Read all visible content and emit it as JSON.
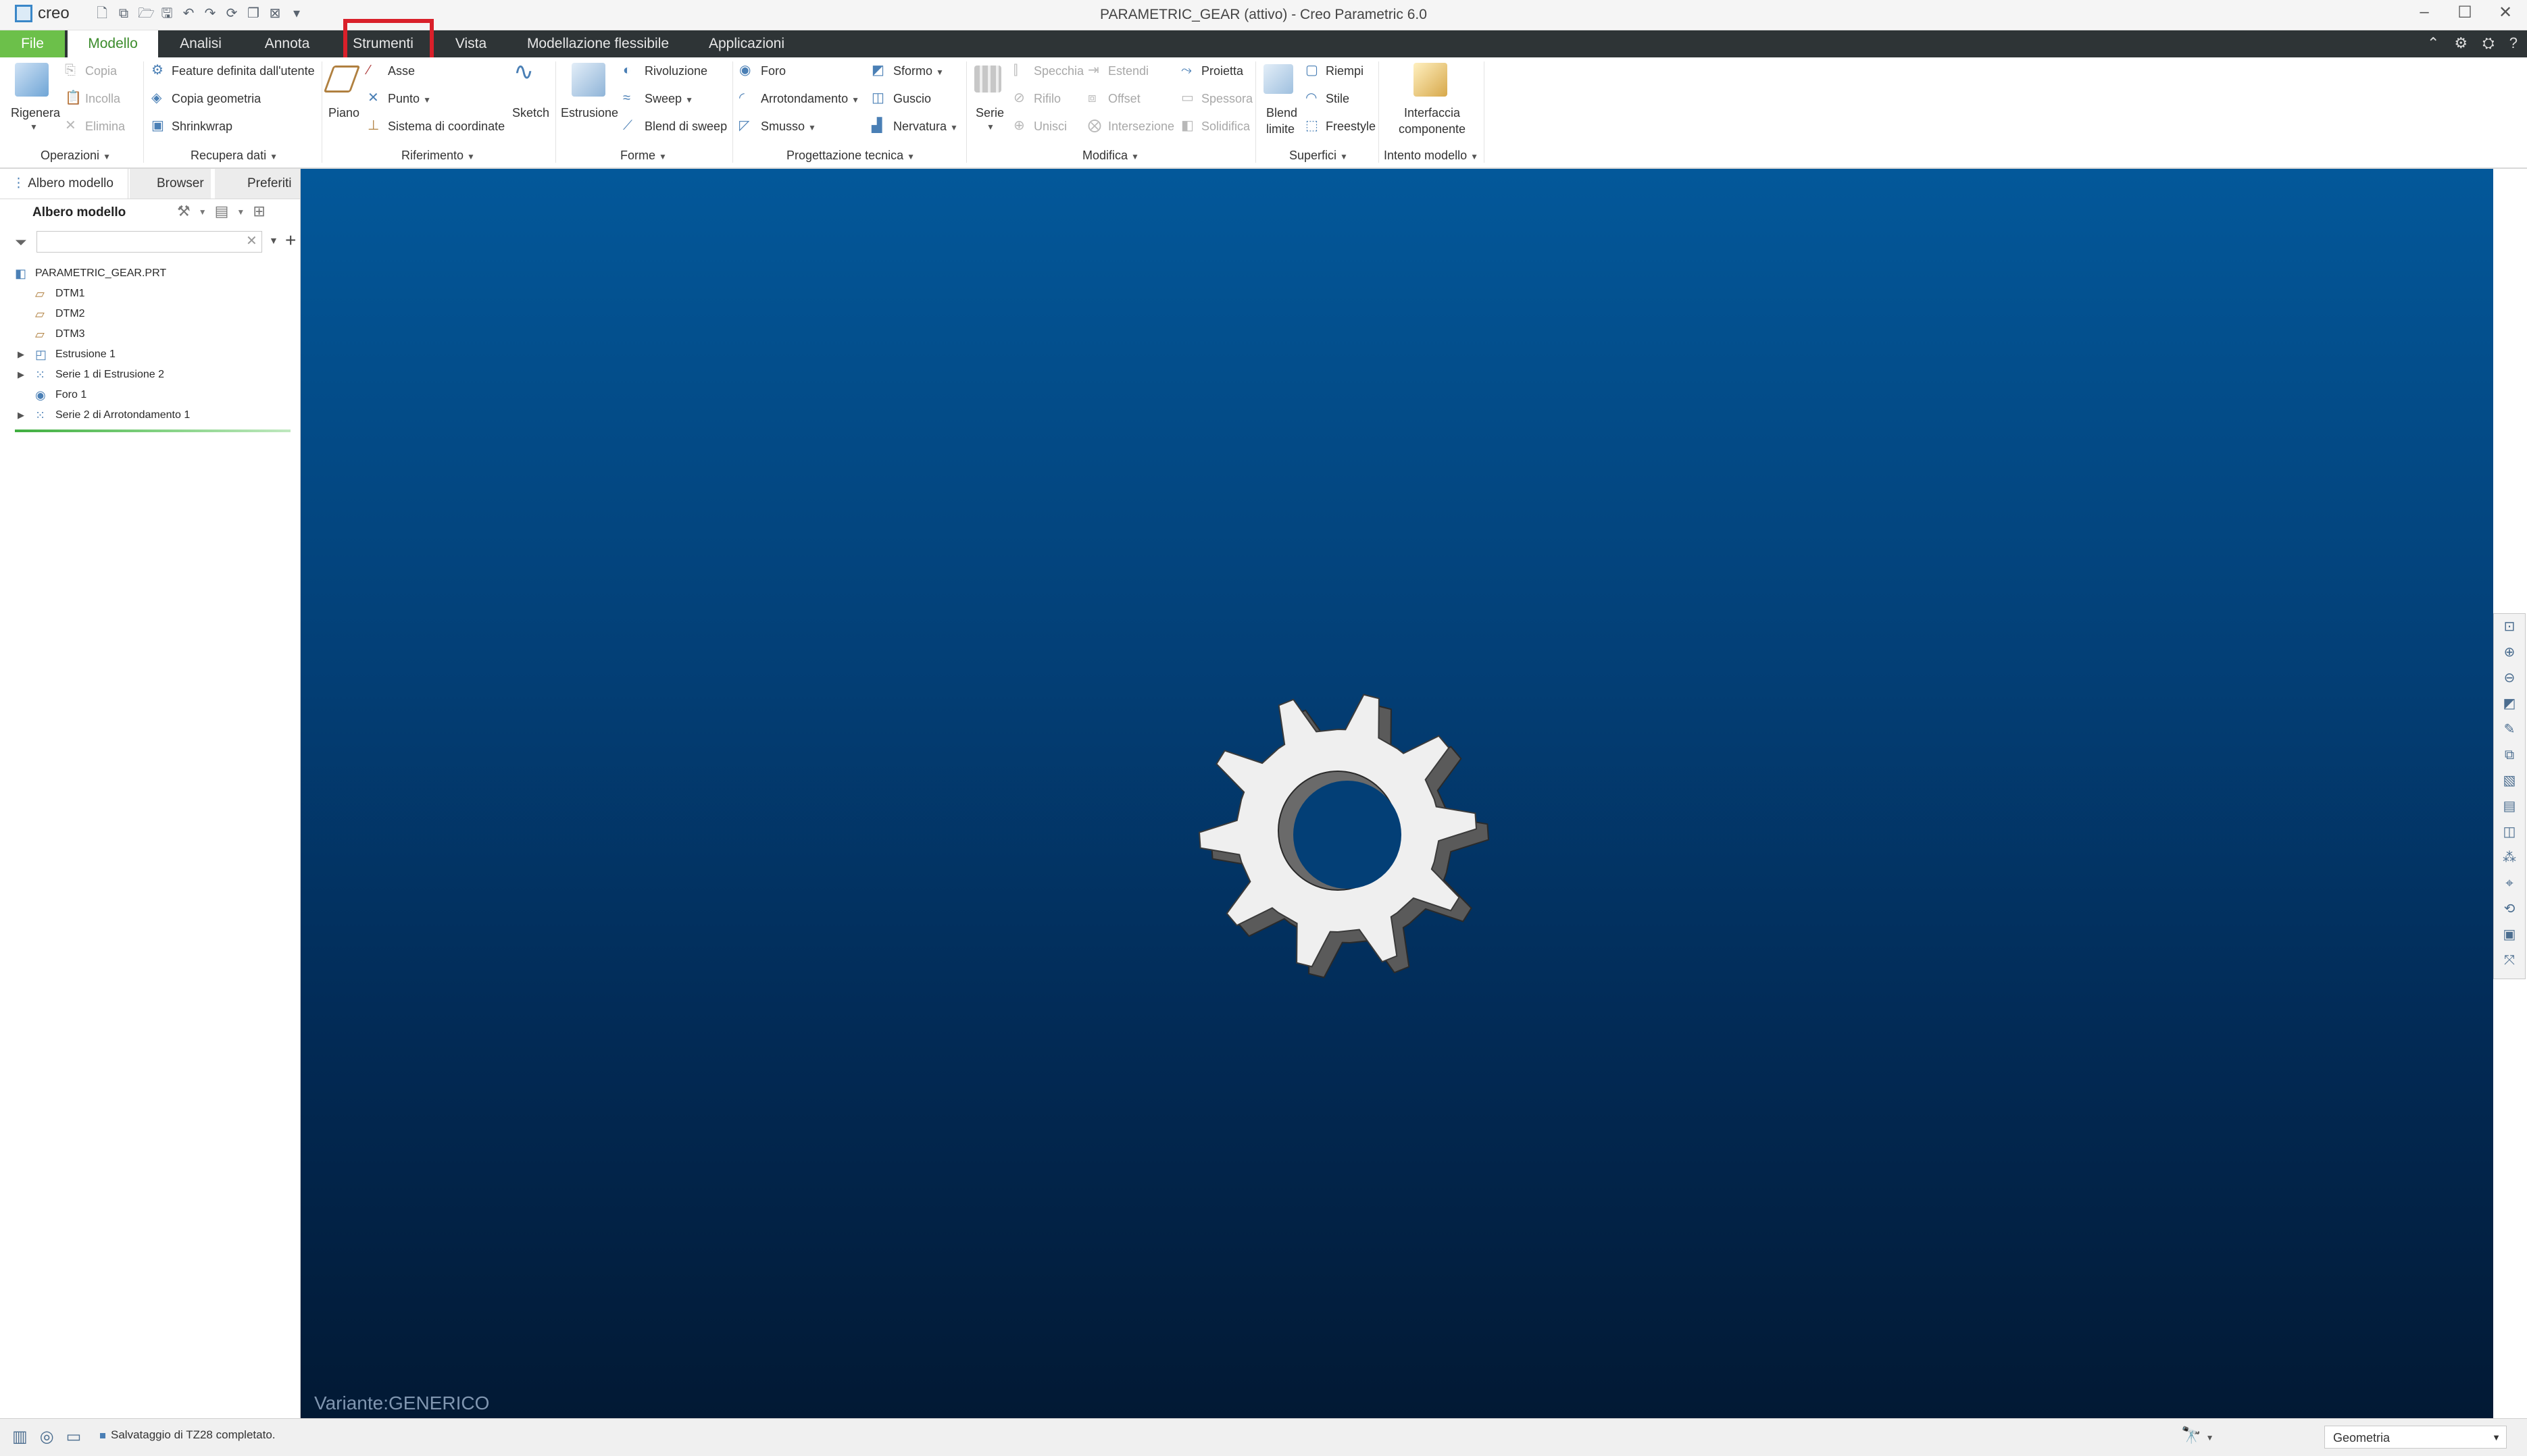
{
  "app": {
    "logo_text": "creo",
    "window_title": "PARAMETRIC_GEAR (attivo) - Creo Parametric 6.0"
  },
  "tabs": [
    {
      "label": "File"
    },
    {
      "label": "Modello"
    },
    {
      "label": "Analisi"
    },
    {
      "label": "Annota"
    },
    {
      "label": "Strumenti"
    },
    {
      "label": "Vista"
    },
    {
      "label": "Modellazione flessibile"
    },
    {
      "label": "Applicazioni"
    }
  ],
  "active_tab": "Modello",
  "highlighted_tab": "Strumenti",
  "colors": {
    "highlight_box": "#d9202a",
    "file_tab": "#6cc04a",
    "tab_bar": "#2e3436",
    "viewport_top": "#03589a",
    "viewport_bottom": "#021934"
  },
  "ribbon": {
    "operazioni": {
      "group_label": "Operazioni",
      "rigenera": "Rigenera",
      "copia": "Copia",
      "incolla": "Incolla",
      "elimina": "Elimina"
    },
    "recupera_dati": {
      "group_label": "Recupera dati",
      "feature_utente": "Feature definita dall'utente",
      "copia_geometria": "Copia geometria",
      "shrinkwrap": "Shrinkwrap"
    },
    "riferimento": {
      "group_label": "Riferimento",
      "piano": "Piano",
      "asse": "Asse",
      "punto": "Punto",
      "sistema_coordinate": "Sistema di coordinate",
      "sketch": "Sketch"
    },
    "forme": {
      "group_label": "Forme",
      "estrusione": "Estrusione",
      "rivoluzione": "Rivoluzione",
      "sweep": "Sweep",
      "blend_sweep": "Blend di sweep"
    },
    "progettazione_tecnica": {
      "group_label": "Progettazione tecnica",
      "foro": "Foro",
      "arrotondamento": "Arrotondamento",
      "smusso": "Smusso",
      "sformo": "Sformo",
      "guscio": "Guscio",
      "nervatura": "Nervatura"
    },
    "modifica": {
      "group_label": "Modifica",
      "serie": "Serie",
      "specchia": "Specchia",
      "rifilo": "Rifilo",
      "unisci": "Unisci",
      "estendi": "Estendi",
      "offset": "Offset",
      "intersezione": "Intersezione",
      "proietta": "Proietta",
      "spessora": "Spessora",
      "solidifica": "Solidifica"
    },
    "superfici": {
      "group_label": "Superfici",
      "blend": "Blend",
      "limite": "limite",
      "riempi": "Riempi",
      "stile": "Stile",
      "freestyle": "Freestyle"
    },
    "intento_modello": {
      "group_label": "Intento modello",
      "interfaccia": "Interfaccia",
      "componente": "componente"
    }
  },
  "left_panel": {
    "tabs": [
      {
        "label": "Albero modello"
      },
      {
        "label": "Browser"
      },
      {
        "label": "Preferiti"
      }
    ],
    "tree_title": "Albero modello",
    "filter_value": "",
    "tree_items": [
      {
        "label": "PARAMETRIC_GEAR.PRT",
        "icon": "part-icon",
        "expandable": false
      },
      {
        "label": "DTM1",
        "icon": "datum-plane-icon",
        "expandable": false
      },
      {
        "label": "DTM2",
        "icon": "datum-plane-icon",
        "expandable": false
      },
      {
        "label": "DTM3",
        "icon": "datum-plane-icon",
        "expandable": false
      },
      {
        "label": "Estrusione 1",
        "icon": "extrude-icon",
        "expandable": true
      },
      {
        "label": "Serie 1 di Estrusione 2",
        "icon": "pattern-icon",
        "expandable": true
      },
      {
        "label": "Foro 1",
        "icon": "hole-icon",
        "expandable": false
      },
      {
        "label": "Serie 2 di Arrotondamento 1",
        "icon": "pattern-icon",
        "expandable": true
      }
    ]
  },
  "viewport": {
    "variant_label": "Variante:GENERICO",
    "gear_teeth": 10
  },
  "status_bar": {
    "message": "Salvataggio di TZ28 completato.",
    "selection_filter": "Geometria"
  }
}
